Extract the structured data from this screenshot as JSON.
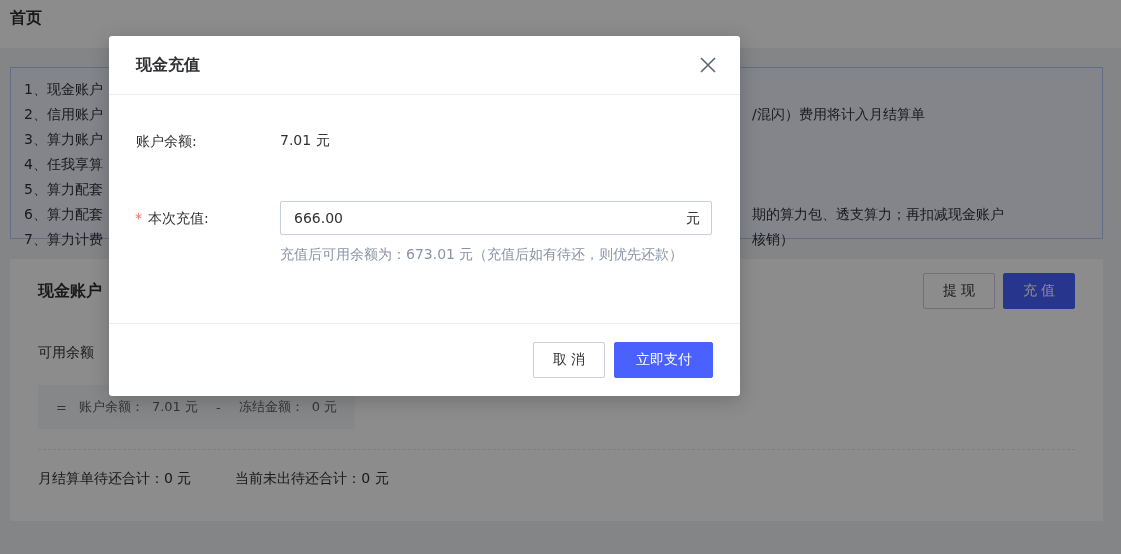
{
  "page": {
    "title": "首页"
  },
  "notice": {
    "lines": [
      {
        "start": "1、现金账户"
      },
      {
        "start": "2、信用账户",
        "end": "/混闪）费用将计入月结算单"
      },
      {
        "start": "3、算力账户"
      },
      {
        "start": "4、任我享算"
      },
      {
        "start": "5、算力配套"
      },
      {
        "start": "6、算力配套",
        "end": "期的算力包、透支算力；再扣减现金账户"
      },
      {
        "start": "7、算力计费",
        "end": "核销）"
      }
    ]
  },
  "account_card": {
    "title": "现金账户",
    "buttons": [
      {
        "label": "提 现",
        "kind": "default"
      },
      {
        "label": "充 值",
        "kind": "primary"
      }
    ],
    "available_label": "可用余额",
    "formula": {
      "equals": "=",
      "balance_label": "账户余额：",
      "balance": "7.01 元",
      "minus": "-",
      "frozen_label": "冻结金额：",
      "frozen": "0 元"
    },
    "totals": [
      "月结算单待还合计：0 元",
      "当前未出待还合计：0 元"
    ]
  },
  "dialog": {
    "title": "现金充值",
    "fields": [
      {
        "kind": "static",
        "label": "账户余额:",
        "value": "7.01 元"
      },
      {
        "kind": "input",
        "label": "本次充值:",
        "required_mark": "*",
        "value": "666.00",
        "suffix": "元",
        "hint": "充值后可用余额为：673.01 元（充值后如有待还，则优先还款）"
      }
    ],
    "buttons": [
      {
        "label": "取 消",
        "kind": "default"
      },
      {
        "label": "立即支付",
        "kind": "primary"
      }
    ]
  }
}
